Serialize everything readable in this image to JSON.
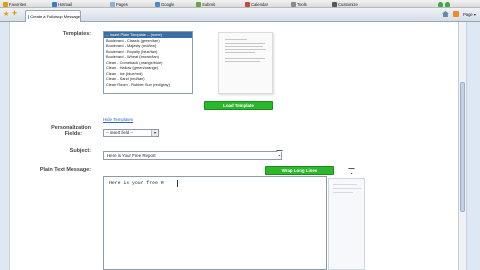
{
  "toolbar": {
    "links": [
      {
        "label": "Favorites",
        "icon": "star-icon"
      },
      {
        "label": "Hotmail",
        "icon": "mail-icon"
      },
      {
        "label": "Pages",
        "icon": "page-icon"
      },
      {
        "label": "Google",
        "icon": "google-icon"
      },
      {
        "label": "Submit",
        "icon": "submit-icon"
      },
      {
        "label": "Calendar",
        "icon": "calendar-icon"
      },
      {
        "label": "Tools",
        "icon": "tools-icon"
      },
      {
        "label": "Customize",
        "icon": "gear-icon"
      }
    ]
  },
  "tab": {
    "label": "Create a Followup Message"
  },
  "browser": {
    "page_label": "Page"
  },
  "form": {
    "templates_label": "Templates:",
    "template_options": [
      "-- Insert Plain Template -- (none)",
      "Boulevard - Classic (green/tan)",
      "Boulevard - Majesty (red/tan)",
      "Boulevard - Royalty (blue/tan)",
      "Boulevard - Wheat (brown/tan)",
      "Clean - Comeback (orange/blue)",
      "Clean - Hallow (green/orange)",
      "Clean - Ice (blue/red)",
      "Clean - Sand (red/tan)",
      "Clean Room - Rubber Sun (red/gray)"
    ],
    "load_button": "Load Template",
    "hide_link": "Hide Templates",
    "personalization_label_1": "Personalization",
    "personalization_label_2": "Fields:",
    "personalization_value": "-- insert field --",
    "subject_label": "Subject:",
    "subject_value": "Here is Your Free Report",
    "plain_text_label": "Plain Text Message:",
    "wrap_button": "Wrap Long Lines",
    "message_body": "Here is your free R"
  },
  "colors": {
    "accent": "#2db72d",
    "selection": "#3a6ea5",
    "link": "#3366bb"
  }
}
